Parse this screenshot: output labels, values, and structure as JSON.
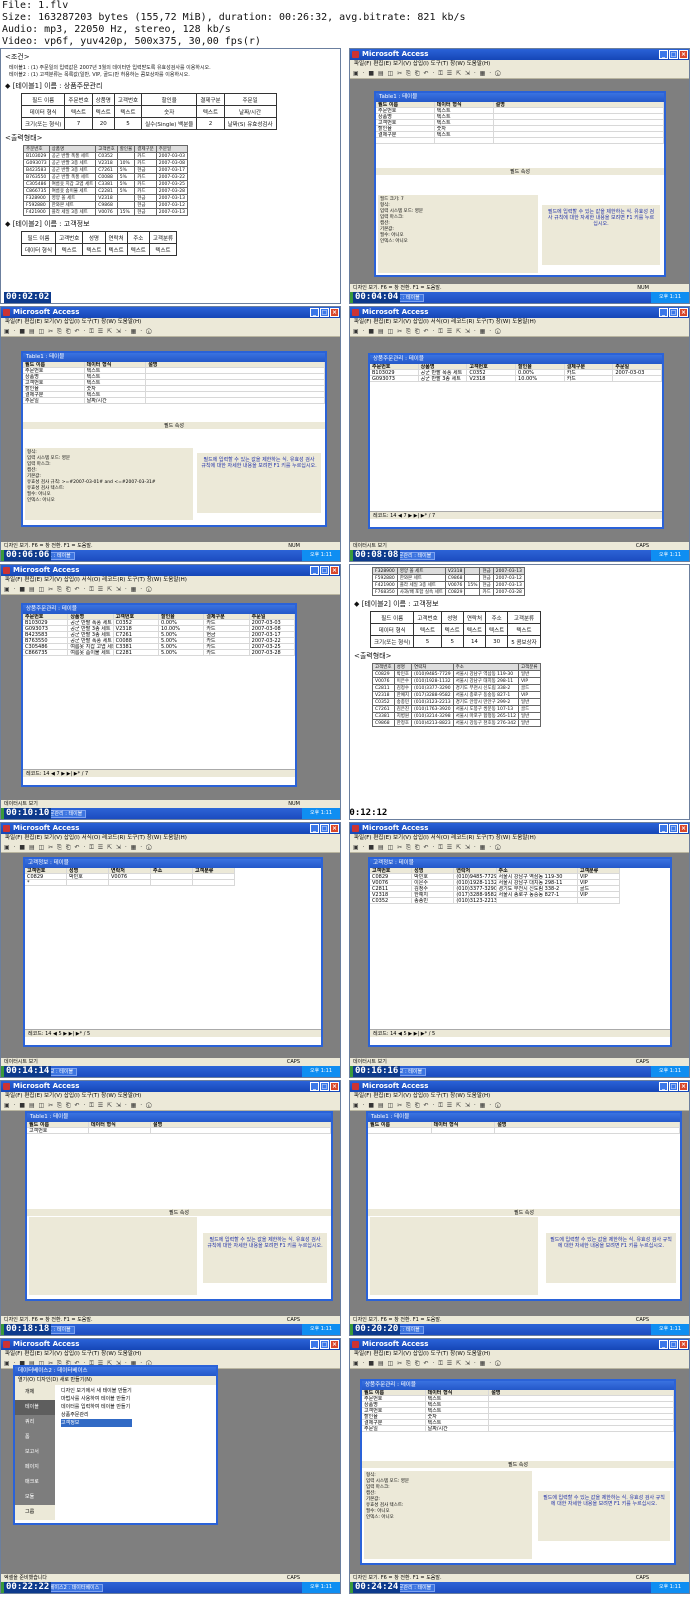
{
  "header": {
    "line1": "File: 1.flv",
    "line2": "Size: 163287203 bytes (155,72 MiB), duration: 00:26:32, avg.bitrate: 821 kb/s",
    "line3": "Audio: mp3, 22050 Hz, stereo, 128 kb/s",
    "line4": "Video: vp6f, yuv420p, 500x375, 30,00 fps(r)"
  },
  "app": {
    "title": "Microsoft Access",
    "menu": "파일(F)  편집(E)  보기(V)  삽입(I)  도구(T)  창(W)  도움말(H)",
    "menu_ds": "파일(F)  편집(E)  보기(V)  삽입(I)  서식(O)  레코드(R)  도구(T)  창(W)  도움말(H)",
    "toolbar": "▣ · ■ ▤ ◫ ✂ ⎘ ⎗ ↶ · ⚿ ☰ ⇱ ⇲ · ▦ · ⓘ",
    "status_design": "디자인 보기.  F6 = 창 전환.  F1 = 도움말.",
    "status_ds": "데이터시트 보기",
    "status_num": "NUM",
    "status_caps": "CAPS",
    "status_db": "엑셀을 준비했습니다",
    "start": "시작",
    "tray": "오후 1:11"
  },
  "timestamps": [
    "00:02:02",
    "00:04:04",
    "00:06:06",
    "00:08:08",
    "00:10:10",
    "00:12:12",
    "00:14:14",
    "00:16:16",
    "00:18:18",
    "00:20:20",
    "00:22:22",
    "00:24:24"
  ],
  "doc": {
    "cond_title": "<조건>",
    "cond1": "테이블1 : (1) 주문일의 입력값은 2007년 3월의 데이터만 입력받도록 유효성검사를 이용하시오.",
    "cond2": "테이블2 : (1) 고객분류는 목록값(일반, VIP, 골드)만 허용하는 콤보상자를 이용하시오.",
    "table1_title": "[테이블1] 이름 : 상품주문관리",
    "table1_rows": [
      [
        "필드 이름",
        "주문번호",
        "상품명",
        "고객번호",
        "할인율",
        "결제구분",
        "주문일"
      ],
      [
        "데이터 형식",
        "텍스트",
        "텍스트",
        "텍스트",
        "숫자",
        "텍스트",
        "날짜/시간"
      ],
      [
        "크기(또는 형식)",
        "7",
        "",
        "20",
        "5",
        "실수(Single) 백분율",
        "2",
        "날짜(S) 유효성검사"
      ]
    ],
    "output_title": "<출력형태>",
    "out1": [
      [
        "주문번호",
        "상품명",
        "고객번호",
        "할인율",
        "결제구분",
        "주문일"
      ],
      [
        "B103029",
        "공군 반팔 폭풍 세트",
        "C0352",
        "",
        "카드",
        "2007-03-03"
      ],
      [
        "G093073",
        "공군 반팔 3종 세트",
        "V2318",
        "10%",
        "카드",
        "2007-03-08"
      ],
      [
        "B423583",
        "공군 반팔 3종 세트",
        "C7261",
        "5%",
        "현금",
        "2007-03-17"
      ],
      [
        "B763550",
        "공군 반팔 폭풍 세트",
        "C0088",
        "5%",
        "카드",
        "2007-03-22"
      ],
      [
        "C305486",
        "여름옷 지갑 고엽 세트",
        "C3381",
        "5%",
        "카드",
        "2007-03-25"
      ],
      [
        "C866735",
        "여름옷 솜이불 세트",
        "C2281",
        "5%",
        "카드",
        "2007-03-28"
      ],
      [
        "F328900",
        "영양 올 세트",
        "V2318",
        "",
        "현금",
        "2007-03-13"
      ],
      [
        "F592880",
        "한와본 세트",
        "C9868",
        "",
        "현금",
        "2007-03-12"
      ],
      [
        "F421900",
        "플라 세일 3종 세트",
        "V0076",
        "15%",
        "현금",
        "2007-03-13"
      ],
      [
        "F768350",
        "사과/배 포함 실속 세트",
        "C0829",
        "",
        "카드",
        "2007-03-28"
      ]
    ],
    "table2_title": "[테이블2] 이름 : 고객정보",
    "table2_rows": [
      [
        "필드 이름",
        "고객번호",
        "성명",
        "연락처",
        "주소",
        "고객분류"
      ],
      [
        "데이터 형식",
        "텍스트",
        "텍스트",
        "텍스트",
        "텍스트",
        "텍스트"
      ],
      [
        "크기(또는 형식)",
        "5",
        "5",
        "14",
        "30",
        "5 콤보상자"
      ]
    ],
    "out2": [
      [
        "고객번호",
        "성명",
        "연락처",
        "주소",
        "고객분류"
      ],
      [
        "C0829",
        "박민호",
        "(010)9485-7729",
        "서울시 강남구 역삼동 119-30",
        "일반"
      ],
      [
        "V0076",
        "이은수",
        "(010)1928-1132",
        "서울시 강남구 대치동 298-11",
        "VIP"
      ],
      [
        "C2811",
        "김정수",
        "(010)3377-3290",
        "경기도 부천시 신도림 338-2",
        "골드"
      ],
      [
        "V2318",
        "한예지",
        "(017)3288-9582",
        "서울시 종로구 동숭동 827-1",
        "VIP"
      ],
      [
        "C0352",
        "송종민",
        "(010)3123-2213",
        "경기도 안양시 만안구 299-2",
        "일반"
      ],
      [
        "C7261",
        "김은진",
        "(010)1763-3920",
        "서울시 도봉구 쌍문동 107-13",
        "골드"
      ],
      [
        "C3381",
        "지병원",
        "(010)3214-3298",
        "서울시 마포구 합정동 265-112",
        "일반"
      ],
      [
        "C9868",
        "한정호",
        "(010)4213-8823",
        "서울시 강동구 천호동 276-342",
        "일반"
      ]
    ]
  },
  "table1_design": {
    "title": "Table1 : 테이블",
    "cols": [
      "필드 이름",
      "데이터 형식",
      "설명"
    ],
    "fields": [
      [
        "주문번호",
        "텍스트"
      ],
      [
        "상품명",
        "텍스트"
      ],
      [
        "고객번호",
        "텍스트"
      ],
      [
        "할인율",
        "숫자"
      ],
      [
        "결제구분",
        "텍스트"
      ],
      [
        "주문일",
        "날짜/시간"
      ]
    ],
    "prop_title": "필드 속성",
    "props": [
      "필드 크기: 7",
      "형식:",
      "입력 시스템 모드: 영문",
      "입력 마스크:",
      "캡션:",
      "기본값:",
      "유효성 검사 규칙: >=#2007-03-01# and <=#2007-03-31#",
      "유효성 검사 텍스트:",
      "필수: 아니오",
      "인덱스: 아니오"
    ],
    "hint": "필드에 입력할 수 있는 값을 제한하는 식. 유효성 검사 규칙에 대한 자세한 내용을 보려면 F1 키를 누르십시오."
  },
  "ds1": {
    "title": "상품주문관리 : 테이블",
    "cols": [
      "주문번호",
      "상품명",
      "고객번호",
      "할인율",
      "결제구분",
      "주문일"
    ],
    "rows": [
      [
        "B103029",
        "공군 반팔 폭풍 세트",
        "C0352",
        "0.00%",
        "카드",
        "2007-03-03"
      ],
      [
        "G093073",
        "공군 반팔 3종 세트",
        "V2318",
        "10.00%",
        "카드",
        "2007-03-08"
      ],
      [
        "B423583",
        "공군 반팔 3종 세트",
        "C7261",
        "5.00%",
        "현금",
        "2007-03-17"
      ],
      [
        "B763550",
        "공군 반팔 폭풍 세트",
        "C0088",
        "5.00%",
        "카드",
        "2007-03-22"
      ],
      [
        "C305486",
        "여름옷 지갑 고엽 세트",
        "C3381",
        "5.00%",
        "카드",
        "2007-03-25"
      ],
      [
        "C866735",
        "여름옷 솜이불 세트",
        "C2281",
        "5.00%",
        "카드",
        "2007-03-28"
      ]
    ],
    "nav": "레코드: 14 ◀ 7 ▶ ▶| ▶* / 7"
  },
  "ds2": {
    "title": "고객정보 : 테이블",
    "cols": [
      "고객번호",
      "성명",
      "연락처",
      "주소",
      "고객분류"
    ],
    "rows": [
      [
        "C0829",
        "박민호",
        "(010)9485-7729",
        "서울시 강남구 역삼동 119-30",
        "VIP"
      ],
      [
        "V0076",
        "이은수",
        "(010)1928-1132",
        "서울시 강남구 대치동 298-11",
        "VIP"
      ],
      [
        "C2811",
        "김정수",
        "(010)3377-3290",
        "경기도 부천시 신도림 338-2",
        "골드"
      ],
      [
        "V2318",
        "한예지",
        "(017)3288-9582",
        "서울시 종로구 동숭동 827-1",
        "VIP"
      ],
      [
        "C0352",
        "송종민",
        "(010)3123-2213",
        "",
        ""
      ]
    ],
    "nav": "레코드: 14 ◀ 5 ▶ ▶| ▶* / 5"
  },
  "dbwin": {
    "title": "데이터베이스2 : 데이터베이스",
    "tools": "열기(O)  디자인(D)  새로 만들기(N)",
    "objects": [
      "개체",
      "테이블",
      "쿼리",
      "폼",
      "보고서",
      "페이지",
      "매크로",
      "모듈",
      "그룹",
      "즐겨찾기"
    ],
    "items": [
      "디자인 보기에서 새 테이블 만들기",
      "마법사를 사용하여 테이블 만들기",
      "데이터를 입력하여 테이블 만들기",
      "상품주문관리",
      "고객정보"
    ]
  }
}
